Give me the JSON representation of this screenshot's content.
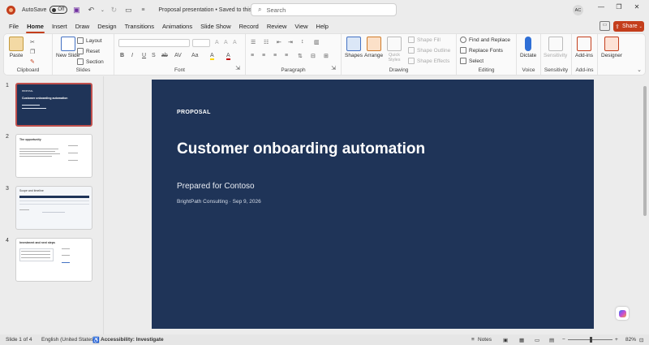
{
  "titlebar": {
    "autosave_label": "AutoSave",
    "autosave_state": "Off",
    "doc_title": "Proposal presentation • Saved to this PC",
    "search_placeholder": "Search",
    "user_initials": "AC"
  },
  "menu": {
    "tabs": [
      "File",
      "Home",
      "Insert",
      "Draw",
      "Design",
      "Transitions",
      "Animations",
      "Slide Show",
      "Record",
      "Review",
      "View",
      "Help"
    ],
    "active": "Home",
    "share_label": "Share"
  },
  "ribbon": {
    "clipboard": {
      "label": "Clipboard",
      "paste": "Paste"
    },
    "slides": {
      "label": "Slides",
      "new_slide": "New Slide",
      "layout": "Layout",
      "reset": "Reset",
      "section": "Section"
    },
    "font": {
      "label": "Font",
      "buttons": [
        "B",
        "I",
        "U",
        "S",
        "ab",
        "AV",
        "Aa",
        "A",
        "A"
      ]
    },
    "paragraph": {
      "label": "Paragraph"
    },
    "drawing": {
      "label": "Drawing",
      "shapes": "Shapes",
      "arrange": "Arrange",
      "quick_styles": "Quick Styles",
      "shape_fill": "Shape Fill",
      "shape_outline": "Shape Outline",
      "shape_effects": "Shape Effects"
    },
    "editing": {
      "label": "Editing",
      "find_replace": "Find and Replace",
      "replace_fonts": "Replace Fonts",
      "select": "Select"
    },
    "voice": {
      "label": "Voice",
      "dictate": "Dictate"
    },
    "sensitivity": {
      "label": "Sensitivity",
      "sensitivity": "Sensitivity"
    },
    "addins": {
      "label": "Add-ins",
      "addins": "Add-ins"
    },
    "designer": {
      "designer": "Designer"
    }
  },
  "thumbnails": [
    {
      "num": "1",
      "title": "Customer onboarding automation",
      "selected": true
    },
    {
      "num": "2",
      "title": "The opportunity",
      "selected": false
    },
    {
      "num": "3",
      "title": "Scope and timeline",
      "selected": false
    },
    {
      "num": "4",
      "title": "Investment and next steps",
      "selected": false
    }
  ],
  "slide": {
    "kicker": "PROPOSAL",
    "title": "Customer onboarding automation",
    "subtitle": "Prepared for Contoso",
    "byline": "BrightPath Consulting · Sep 9, 2026",
    "background": "#1f3458"
  },
  "statusbar": {
    "slide_count": "Slide 1 of 4",
    "language": "English (United States)",
    "accessibility": "Accessibility: Investigate",
    "notes": "Notes",
    "zoom": "82%"
  },
  "colors": {
    "accent": "#c43e1c",
    "slide_bg": "#1f3458"
  }
}
